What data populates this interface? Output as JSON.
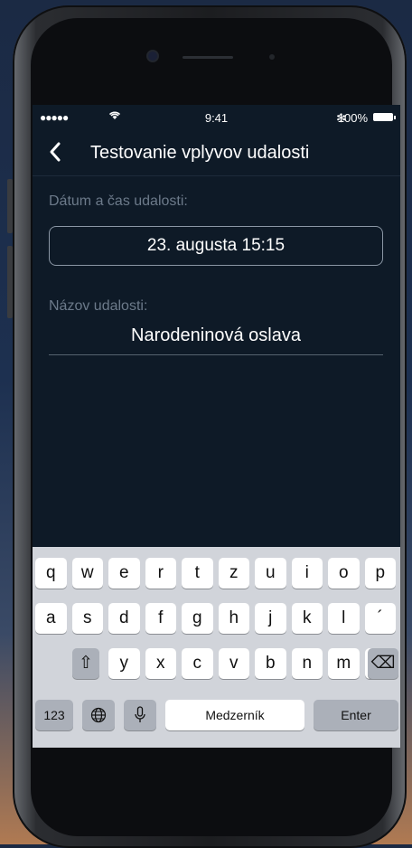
{
  "status": {
    "signal": "●●●●●",
    "wifi": "wifi-icon",
    "time": "9:41",
    "bluetooth": "✻",
    "battery": "100%"
  },
  "nav": {
    "back": "‹",
    "title": "Testovanie vplyvov udalosti"
  },
  "form": {
    "date_label": "Dátum a čas udalosti:",
    "date_value": "23. augusta 15:15",
    "name_label": "Názov udalosti:",
    "name_value": "Narodeninová oslava"
  },
  "keyboard": {
    "row1": [
      "q",
      "w",
      "e",
      "r",
      "t",
      "z",
      "u",
      "i",
      "o",
      "p"
    ],
    "row2": [
      "a",
      "s",
      "d",
      "f",
      "g",
      "h",
      "j",
      "k",
      "l",
      "´"
    ],
    "row3": [
      "y",
      "x",
      "c",
      "v",
      "b",
      "n",
      "m",
      "ˇ"
    ],
    "shift": "⇧",
    "backspace": "⌫",
    "numbers": "123",
    "globe": "🌐",
    "mic": "🎙",
    "space": "Medzerník",
    "enter": "Enter"
  }
}
